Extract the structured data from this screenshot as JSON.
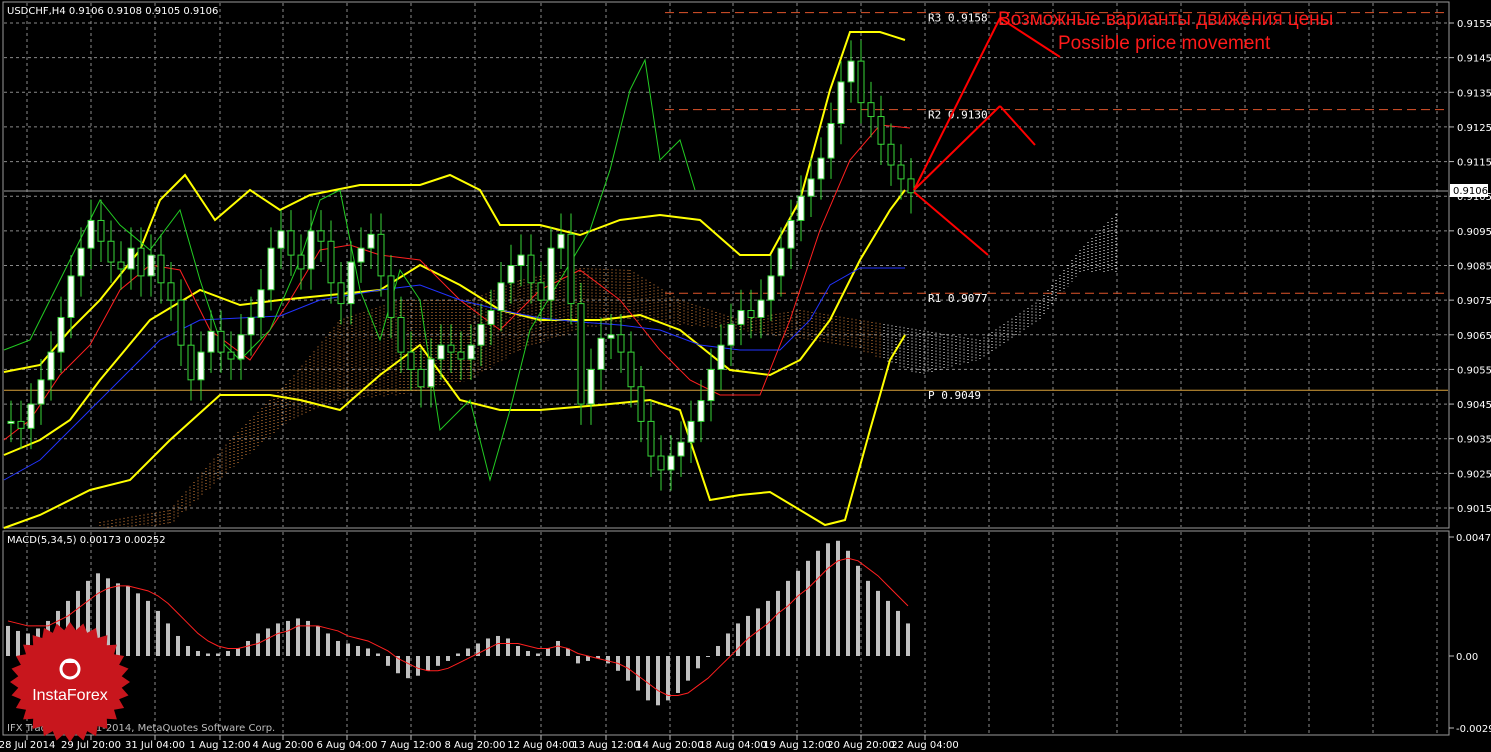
{
  "header": {
    "symbol_line": "USDCHF,H4  0.9106 0.9108 0.9105 0.9106",
    "macd_line": "MACD(5,34,5) 0.00173 0.00252",
    "copyright": "IFX Trader, © 2001-2014, MetaQuotes Software Corp."
  },
  "annotation": {
    "ru": "Возможные варианты движения цены",
    "en": "Possible price movement"
  },
  "logo": {
    "text": "InstaForex"
  },
  "chart_data": [
    {
      "type": "candlestick",
      "symbol": "USDCHF",
      "timeframe": "H4",
      "ohlc": {
        "open": 0.9106,
        "high": 0.9108,
        "low": 0.9105,
        "close": 0.9106
      },
      "current_price_label": "0.9106",
      "ylim": [
        0.901,
        0.9162
      ],
      "y_ticks": [
        "0.9155",
        "0.9145",
        "0.9135",
        "0.9125",
        "0.9115",
        "0.9105",
        "0.9095",
        "0.9085",
        "0.9075",
        "0.9065",
        "0.9055",
        "0.9045",
        "0.9035",
        "0.9025",
        "0.9015"
      ],
      "x_ticks": [
        "28 Jul 2014",
        "29 Jul 20:00",
        "31 Jul 04:00",
        "1 Aug 12:00",
        "4 Aug 20:00",
        "6 Aug 04:00",
        "7 Aug 12:00",
        "8 Aug 20:00",
        "12 Aug 04:00",
        "13 Aug 12:00",
        "14 Aug 20:00",
        "18 Aug 04:00",
        "19 Aug 12:00",
        "20 Aug 20:00",
        "22 Aug 04:00"
      ],
      "pivot_levels": [
        {
          "label": "R3",
          "value_text": "0.9158",
          "value": 0.9158
        },
        {
          "label": "R2",
          "value_text": "0.9130",
          "value": 0.913
        },
        {
          "label": "R1",
          "value_text": "0.9077",
          "value": 0.9077
        },
        {
          "label": "P",
          "value_text": "0.9049",
          "value": 0.9049
        }
      ],
      "candles_close": [
        0.904,
        0.9038,
        0.9045,
        0.9052,
        0.906,
        0.907,
        0.9082,
        0.909,
        0.9098,
        0.9092,
        0.9086,
        0.9084,
        0.909,
        0.9082,
        0.9088,
        0.908,
        0.9075,
        0.9062,
        0.9052,
        0.906,
        0.9066,
        0.906,
        0.9058,
        0.9065,
        0.907,
        0.9078,
        0.909,
        0.9095,
        0.9088,
        0.9084,
        0.9095,
        0.9092,
        0.908,
        0.9074,
        0.9086,
        0.909,
        0.9094,
        0.9082,
        0.907,
        0.906,
        0.9055,
        0.905,
        0.9058,
        0.9062,
        0.906,
        0.9058,
        0.9062,
        0.9068,
        0.9072,
        0.908,
        0.9085,
        0.9088,
        0.908,
        0.9075,
        0.909,
        0.9094,
        0.9074,
        0.9045,
        0.9055,
        0.9064,
        0.9065,
        0.906,
        0.905,
        0.904,
        0.903,
        0.9026,
        0.903,
        0.9034,
        0.904,
        0.9046,
        0.9055,
        0.9062,
        0.9068,
        0.9072,
        0.907,
        0.9075,
        0.9082,
        0.909,
        0.9098,
        0.9105,
        0.911,
        0.9116,
        0.9126,
        0.9138,
        0.9144,
        0.9132,
        0.9128,
        0.912,
        0.9114,
        0.911,
        0.9106
      ],
      "series": [
        {
          "name": "",
          "color": "#ffff00"
        },
        {
          "name": "",
          "color": "#ff2020"
        },
        {
          "name": "",
          "color": "#2233ff"
        },
        {
          "name": "",
          "color": "#22cc22"
        }
      ]
    },
    {
      "type": "bar",
      "title": "MACD(5,34,5)",
      "values_text": [
        "0.00173",
        "0.00252"
      ],
      "ylim": [
        -0.00292,
        0.00475
      ],
      "y_ticks": [
        "0.00475",
        "0.00",
        "-0.00292"
      ],
      "histogram": [
        0.0012,
        0.001,
        0.0009,
        0.0011,
        0.0014,
        0.0018,
        0.0022,
        0.0026,
        0.003,
        0.0033,
        0.0031,
        0.0029,
        0.0028,
        0.0025,
        0.0022,
        0.0018,
        0.0013,
        0.0008,
        0.0004,
        0.0002,
        0.0001,
        0.0001,
        0.0002,
        0.0003,
        0.0006,
        0.0009,
        0.0011,
        0.0013,
        0.0014,
        0.0015,
        0.0014,
        0.0012,
        0.0009,
        0.0006,
        0.0005,
        0.0004,
        0.0003,
        0.0001,
        -0.0004,
        -0.0007,
        -0.0009,
        -0.0008,
        -0.0006,
        -0.0004,
        -0.0002,
        0.0001,
        0.0003,
        0.0005,
        0.0007,
        0.0008,
        0.0007,
        0.0004,
        0.0002,
        0.0001,
        0.0003,
        0.0006,
        0.0003,
        -0.0003,
        -0.0002,
        -0.0001,
        -0.0003,
        -0.0006,
        -0.001,
        -0.0014,
        -0.0018,
        -0.002,
        -0.0018,
        -0.0015,
        -0.001,
        -0.0005,
        0.0,
        0.0004,
        0.0009,
        0.0013,
        0.0016,
        0.0019,
        0.0022,
        0.0026,
        0.003,
        0.0034,
        0.0038,
        0.0042,
        0.0045,
        0.0046,
        0.0042,
        0.0036,
        0.003,
        0.0026,
        0.0022,
        0.0018,
        0.0013
      ],
      "signal": [
        0.0014,
        0.0013,
        0.0012,
        0.0012,
        0.0012,
        0.0014,
        0.0016,
        0.0019,
        0.0022,
        0.0025,
        0.0027,
        0.0028,
        0.0028,
        0.0027,
        0.0026,
        0.0024,
        0.0021,
        0.0017,
        0.0013,
        0.0009,
        0.0006,
        0.0004,
        0.0003,
        0.0003,
        0.0004,
        0.0005,
        0.0007,
        0.0009,
        0.001,
        0.0012,
        0.0012,
        0.0012,
        0.0011,
        0.001,
        0.0008,
        0.0007,
        0.0006,
        0.0004,
        0.0002,
        -0.0001,
        -0.0003,
        -0.0005,
        -0.0006,
        -0.0006,
        -0.0005,
        -0.0003,
        -0.0001,
        0.0001,
        0.0003,
        0.0005,
        0.0005,
        0.0005,
        0.0004,
        0.0003,
        0.0003,
        0.0004,
        0.0003,
        0.0001,
        0.0,
        -0.0001,
        -0.0002,
        -0.0003,
        -0.0005,
        -0.0008,
        -0.0011,
        -0.0014,
        -0.0016,
        -0.0016,
        -0.0015,
        -0.0012,
        -0.0009,
        -0.0005,
        -0.0001,
        0.0003,
        0.0007,
        0.001,
        0.0013,
        0.0017,
        0.002,
        0.0024,
        0.0027,
        0.0031,
        0.0035,
        0.0038,
        0.0039,
        0.0038,
        0.0035,
        0.0032,
        0.0028,
        0.0024,
        0.002
      ],
      "colors": {
        "histogram": "#c0c0c0",
        "signal": "#ff2020"
      }
    }
  ]
}
